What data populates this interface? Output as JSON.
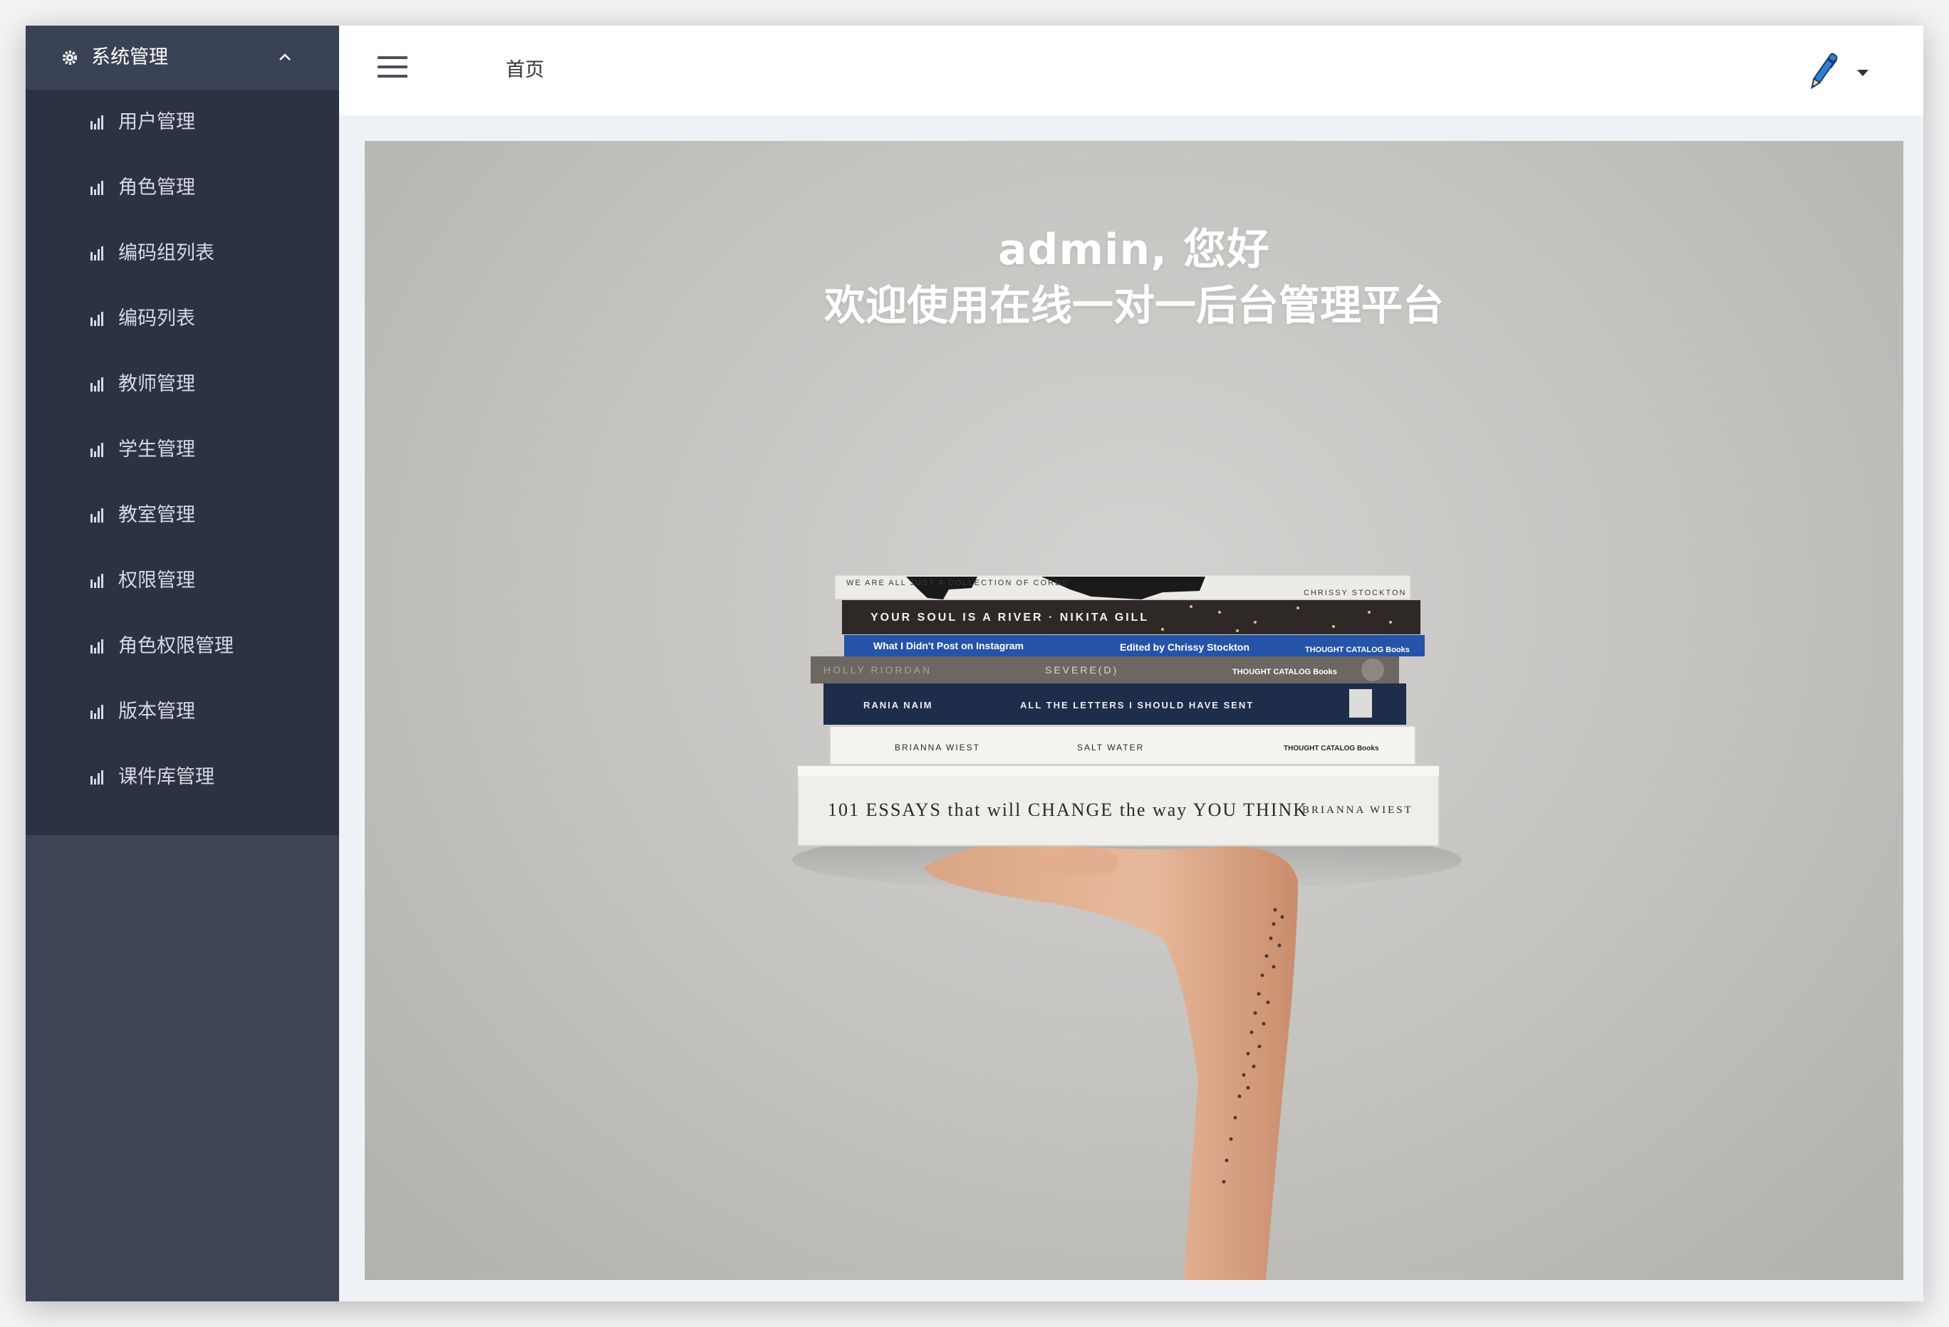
{
  "sidebar": {
    "header_label": "系统管理",
    "header_icon": "gear-icon",
    "expanded": true,
    "items": [
      {
        "label": "用户管理",
        "icon": "bar-chart-icon"
      },
      {
        "label": "角色管理",
        "icon": "bar-chart-icon"
      },
      {
        "label": "编码组列表",
        "icon": "bar-chart-icon"
      },
      {
        "label": "编码列表",
        "icon": "bar-chart-icon"
      },
      {
        "label": "教师管理",
        "icon": "bar-chart-icon"
      },
      {
        "label": "学生管理",
        "icon": "bar-chart-icon"
      },
      {
        "label": "教室管理",
        "icon": "bar-chart-icon"
      },
      {
        "label": "权限管理",
        "icon": "bar-chart-icon"
      },
      {
        "label": "角色权限管理",
        "icon": "bar-chart-icon"
      },
      {
        "label": "版本管理",
        "icon": "bar-chart-icon"
      },
      {
        "label": "课件库管理",
        "icon": "bar-chart-icon"
      }
    ]
  },
  "header": {
    "breadcrumb": "首页",
    "menu_icon": "hamburger-icon",
    "user_icon": "pen-avatar-icon"
  },
  "hero": {
    "greeting": "admin, 您好",
    "welcome": "欢迎使用在线一对一后台管理平台",
    "books": [
      {
        "spine_a": "WE ARE ALL JUST A COLLECTION OF CORDS",
        "spine_b": "CHRISSY STOCKTON"
      },
      {
        "spine_a": "YOUR SOUL IS A RIVER · NIKITA GILL",
        "spine_b": ""
      },
      {
        "spine_a": "What I Didn't Post on Instagram",
        "spine_b": "Edited by Chrissy Stockton",
        "spine_c": "THOUGHT CATALOG Books"
      },
      {
        "spine_a": "HOLLY RIORDAN",
        "spine_b": "SEVERE(D)",
        "spine_c": "THOUGHT CATALOG Books"
      },
      {
        "spine_a": "RANIA NAIM",
        "spine_b": "ALL THE LETTERS I SHOULD HAVE SENT"
      },
      {
        "spine_a": "BRIANNA WIEST",
        "spine_b": "SALT WATER",
        "spine_c": "THOUGHT CATALOG Books"
      },
      {
        "spine_a": "101 ESSAYS that will CHANGE the way YOU THINK",
        "spine_b": "BRIANNA WIEST"
      }
    ]
  },
  "colors": {
    "sidebar_bg": "#3c4456",
    "submenu_bg": "#2b3244",
    "content_bg": "#eef2f6",
    "pen_blue": "#2f7fd6"
  }
}
